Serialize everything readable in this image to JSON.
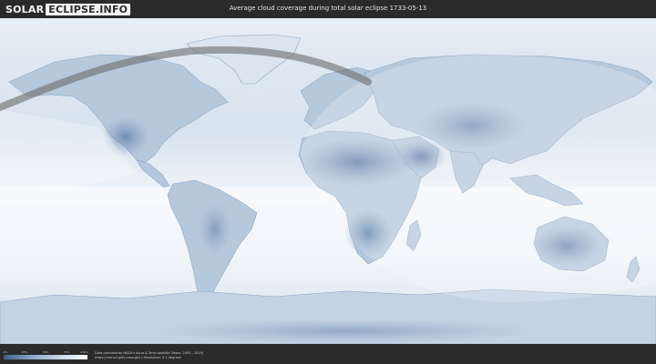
{
  "header": {
    "logo_part1": "SOLAR",
    "logo_part2": "ECLIPSE.INFO",
    "title": "Average cloud coverage during total solar eclipse 1733-05-13"
  },
  "legend": {
    "ticks": [
      "0%",
      "25%",
      "50%",
      "75%",
      "100%"
    ]
  },
  "footer": {
    "credit_line1": "Data provided by NASA's Aqua & Terra satellite (Years: 2000 - 2019)",
    "credit_line2": "https://neo.sci.gsfc.nasa.gov | Resolution: 0.1 degrees"
  },
  "colors": {
    "cloud_white": "#f3f6fa",
    "clear_blue": "#5d7fab",
    "eclipse_path": "#6b6b6b",
    "shadow_overlay": "#ffffff"
  }
}
